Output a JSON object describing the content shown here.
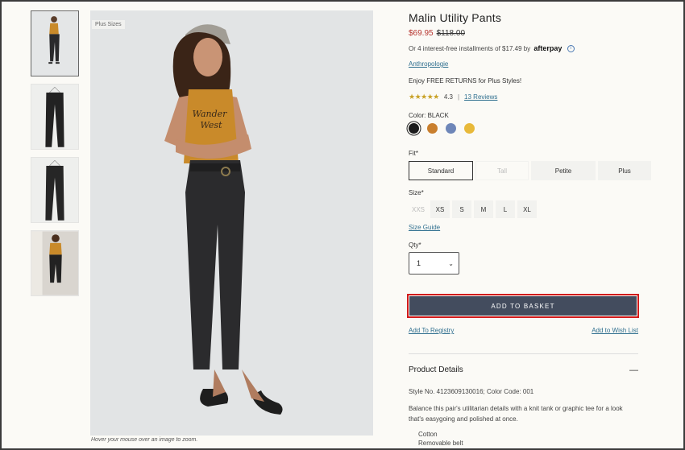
{
  "product": {
    "title": "Malin Utility Pants",
    "sale_price": "$69.95",
    "original_price": "$118.00",
    "installments_text": "Or 4 interest-free installments of $17.49 by",
    "afterpay_logo": "afterpay",
    "brand": "Anthropologie",
    "returns_text": "Enjoy FREE RETURNS for Plus Styles!",
    "rating_value": "4.3",
    "reviews_link": "13 Reviews",
    "color_label": "Color: BLACK",
    "swatches": [
      "#1b1b1b",
      "#c97f2e",
      "#6e86b8",
      "#e8b93a"
    ],
    "fit_label": "Fit*",
    "fit_options": [
      "Standard",
      "Tall",
      "Petite",
      "Plus"
    ],
    "size_label": "Size*",
    "sizes": [
      "XXS",
      "XS",
      "S",
      "M",
      "L",
      "XL"
    ],
    "size_guide": "Size Guide",
    "qty_label": "Qty*",
    "qty_value": "1",
    "add_to_basket": "ADD TO BASKET",
    "add_to_registry": "Add To Registry",
    "add_to_wishlist": "Add to Wish List",
    "details_heading": "Product Details",
    "details_toggle": "—",
    "style_number": "Style No. 4123609130016; Color Code: 001",
    "description": "Balance this pair's utilitarian details with a knit tank or graphic tee for a look that's easygoing and polished at once.",
    "features": [
      "Cotton",
      "Removable belt"
    ]
  },
  "gallery": {
    "plus_tag": "Plus Sizes",
    "hover_hint": "Hover your mouse over an image to zoom.",
    "shirt_text_1": "Wander",
    "shirt_text_2": "West"
  }
}
